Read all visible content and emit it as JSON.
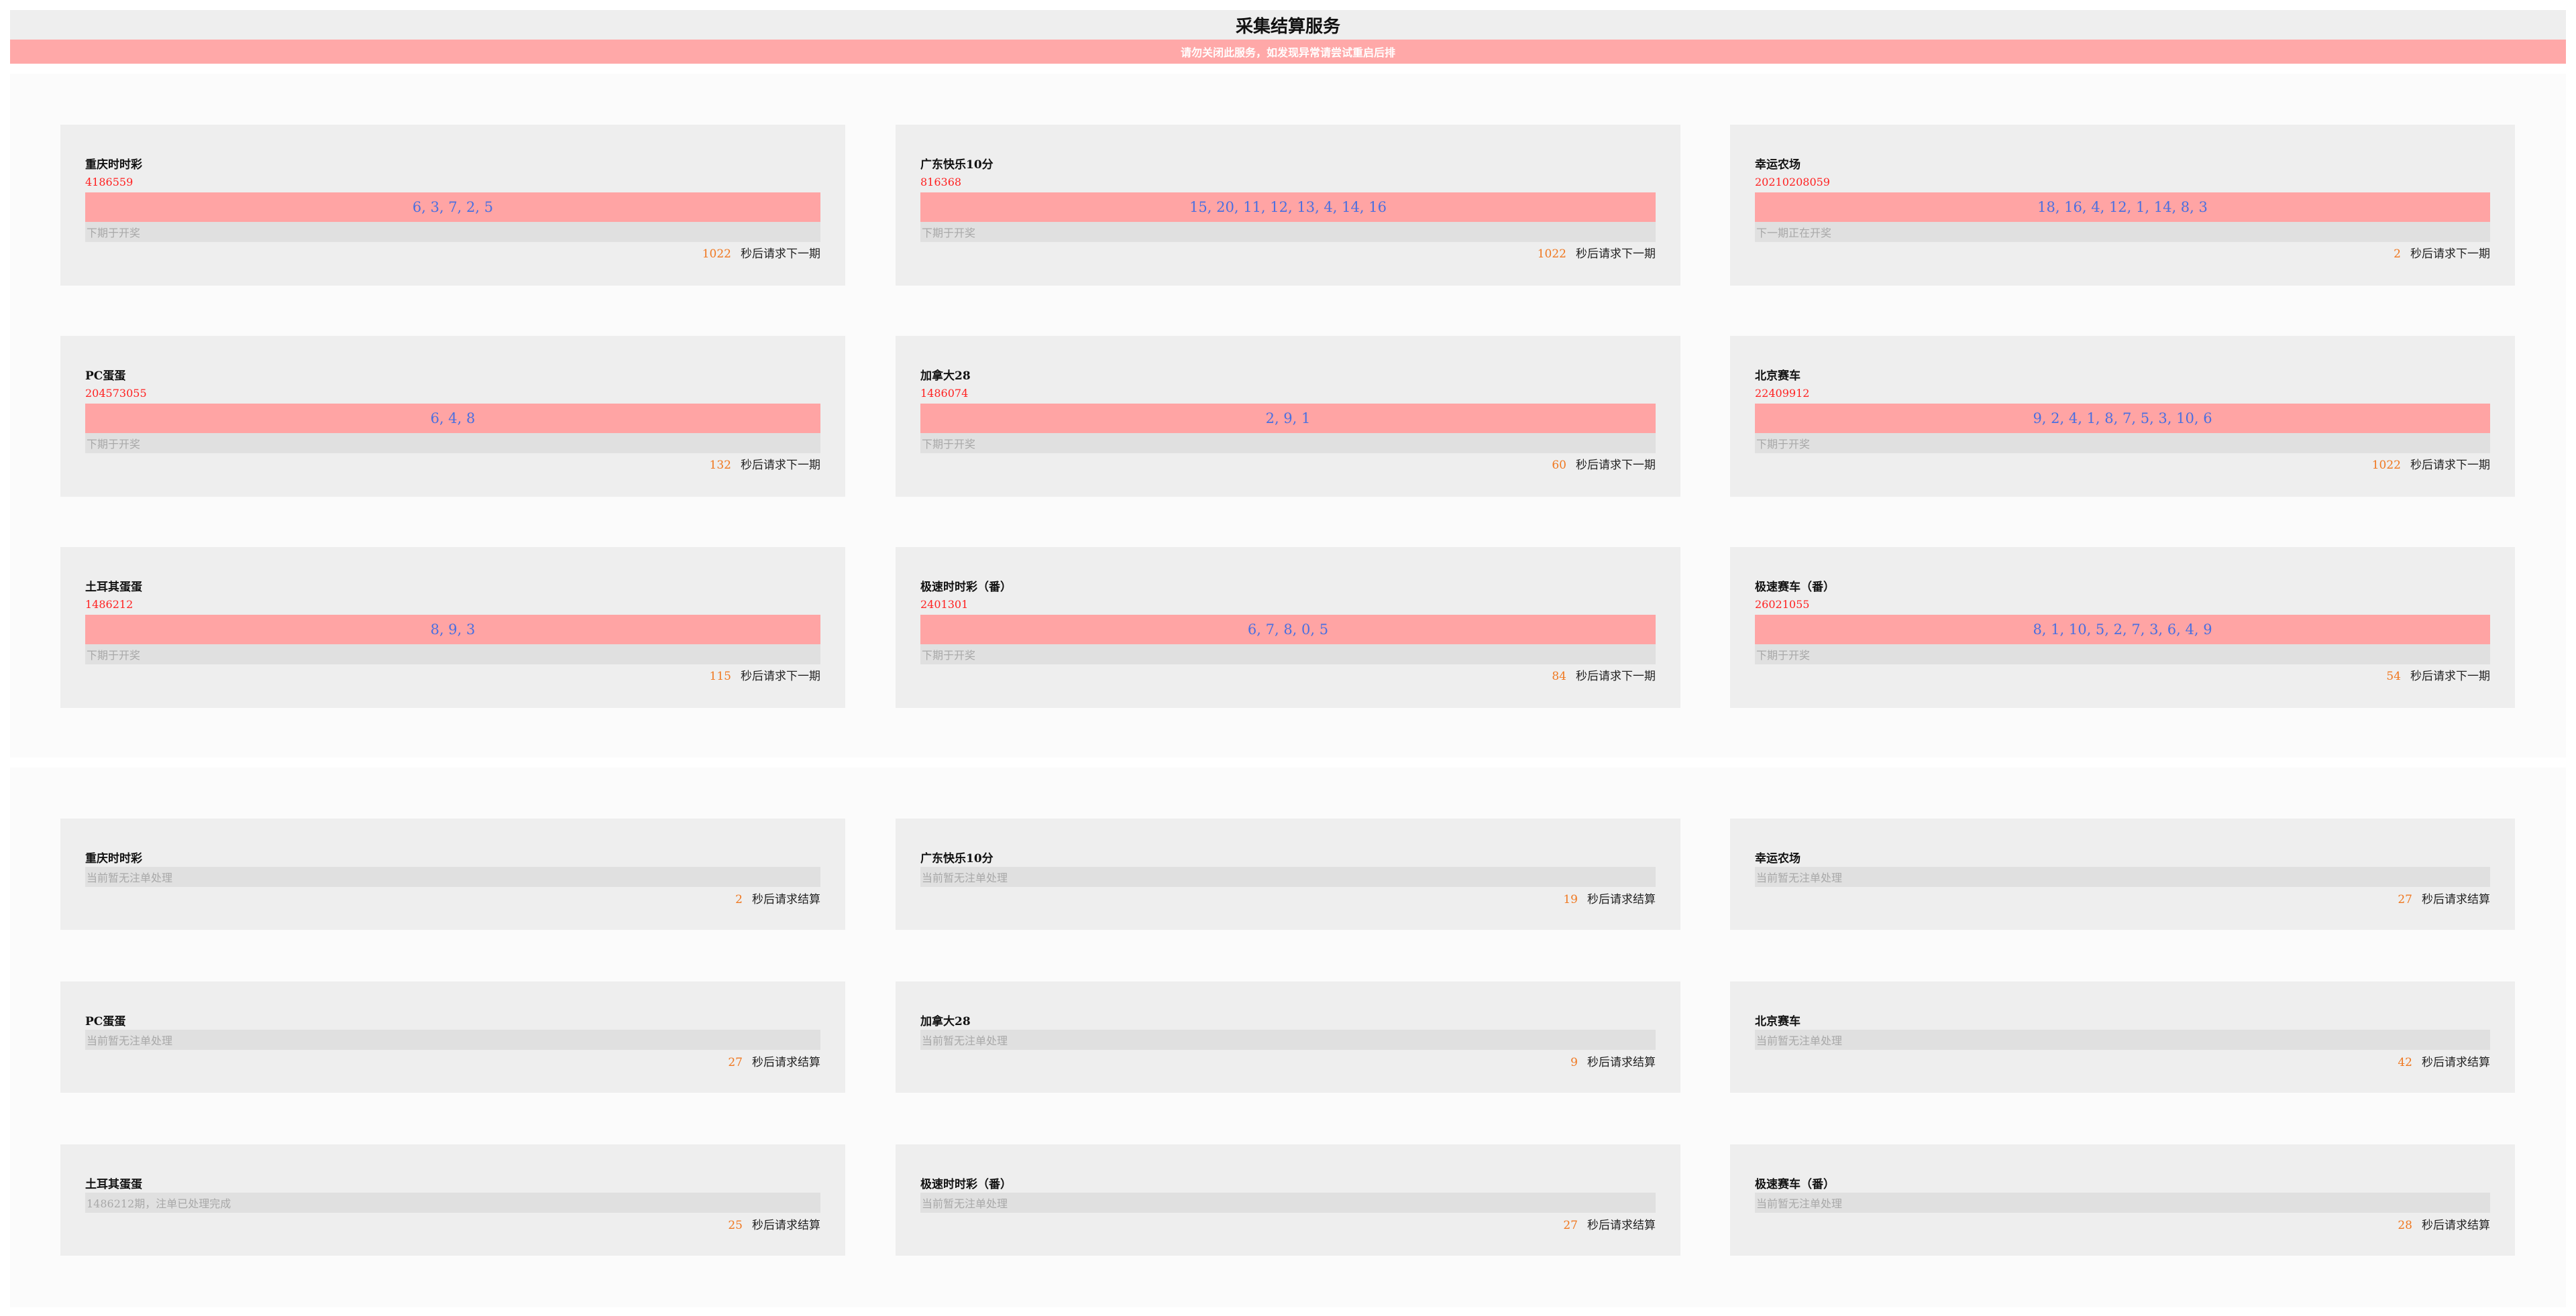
{
  "header": {
    "title": "采集结算服务",
    "warning": "请勿关闭此服务，如发现异常请尝试重启后排"
  },
  "draw_suffix": "秒后请求下一期",
  "settle_suffix": "秒后请求结算",
  "draw_cards": [
    {
      "name": "重庆时时彩",
      "issue": "4186559",
      "numbers": "6, 3, 7, 2, 5",
      "status": "下期于开奖",
      "countdown": "1022"
    },
    {
      "name": "广东快乐10分",
      "issue": "816368",
      "numbers": "15, 20, 11, 12, 13, 4, 14, 16",
      "status": "下期于开奖",
      "countdown": "1022"
    },
    {
      "name": "幸运农场",
      "issue": "20210208059",
      "numbers": "18, 16, 4, 12, 1, 14, 8, 3",
      "status": "下一期正在开奖",
      "countdown": "2"
    },
    {
      "name": "PC蛋蛋",
      "issue": "204573055",
      "numbers": "6, 4, 8",
      "status": "下期于开奖",
      "countdown": "132"
    },
    {
      "name": "加拿大28",
      "issue": "1486074",
      "numbers": "2, 9, 1",
      "status": "下期于开奖",
      "countdown": "60"
    },
    {
      "name": "北京赛车",
      "issue": "22409912",
      "numbers": "9, 2, 4, 1, 8, 7, 5, 3, 10, 6",
      "status": "下期于开奖",
      "countdown": "1022"
    },
    {
      "name": "土耳其蛋蛋",
      "issue": "1486212",
      "numbers": "8, 9, 3",
      "status": "下期于开奖",
      "countdown": "115"
    },
    {
      "name": "极速时时彩（番）",
      "issue": "2401301",
      "numbers": "6, 7, 8, 0, 5",
      "status": "下期于开奖",
      "countdown": "84"
    },
    {
      "name": "极速赛车（番）",
      "issue": "26021055",
      "numbers": "8, 1, 10, 5, 2, 7, 3, 6, 4, 9",
      "status": "下期于开奖",
      "countdown": "54"
    }
  ],
  "settle_cards": [
    {
      "name": "重庆时时彩",
      "status": "当前暂无注单处理",
      "countdown": "2"
    },
    {
      "name": "广东快乐10分",
      "status": "当前暂无注单处理",
      "countdown": "19"
    },
    {
      "name": "幸运农场",
      "status": "当前暂无注单处理",
      "countdown": "27"
    },
    {
      "name": "PC蛋蛋",
      "status": "当前暂无注单处理",
      "countdown": "27"
    },
    {
      "name": "加拿大28",
      "status": "当前暂无注单处理",
      "countdown": "9"
    },
    {
      "name": "北京赛车",
      "status": "当前暂无注单处理",
      "countdown": "42"
    },
    {
      "name": "土耳其蛋蛋",
      "status": "1486212期，注单已处理完成",
      "countdown": "25"
    },
    {
      "name": "极速时时彩（番）",
      "status": "当前暂无注单处理",
      "countdown": "27"
    },
    {
      "name": "极速赛车（番）",
      "status": "当前暂无注单处理",
      "countdown": "28"
    }
  ]
}
